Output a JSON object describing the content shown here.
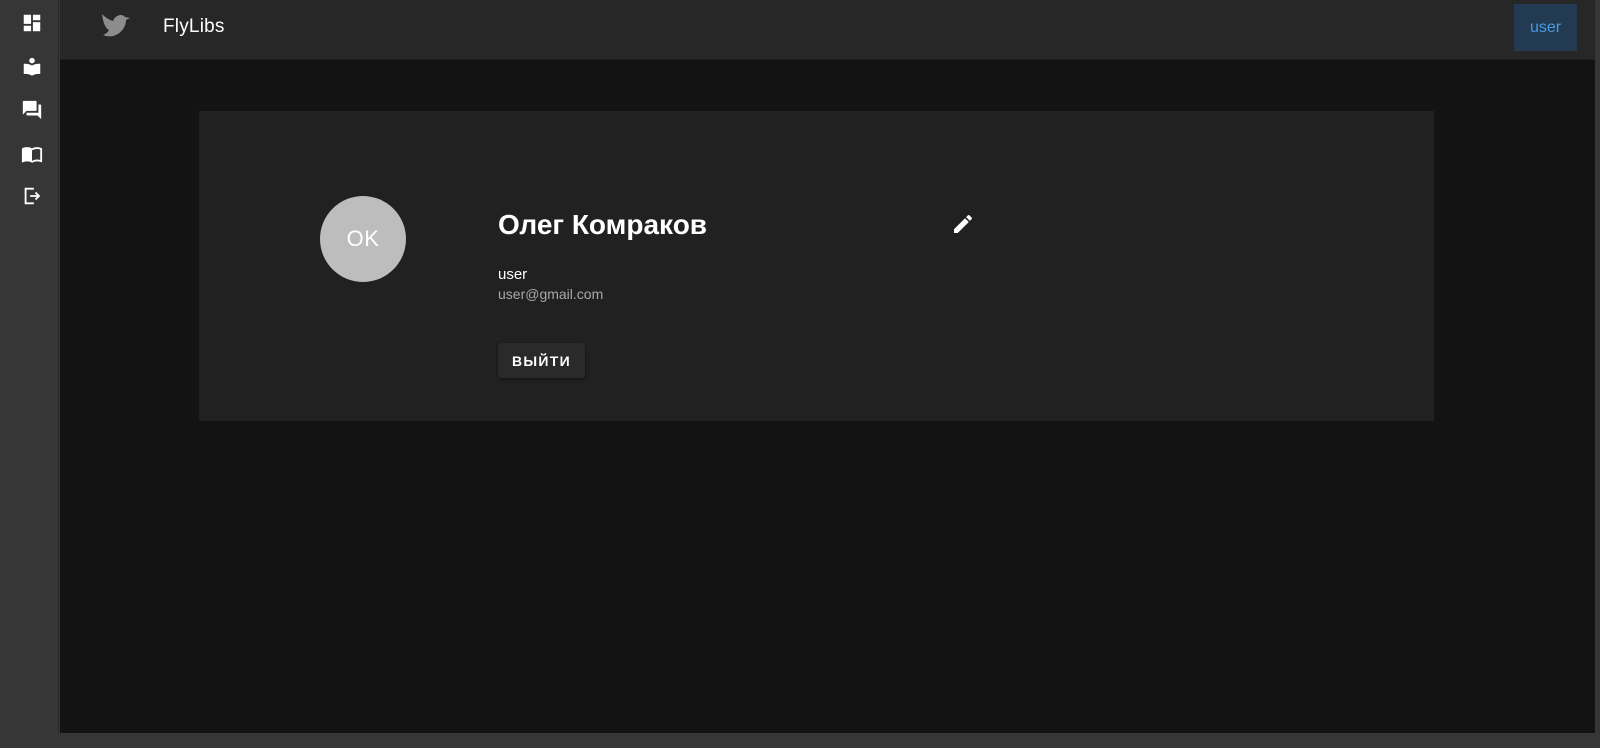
{
  "rail": {
    "items": [
      {
        "icon": "dashboard-icon"
      },
      {
        "icon": "reader-icon"
      },
      {
        "icon": "forum-icon"
      },
      {
        "icon": "book-icon"
      },
      {
        "icon": "logout-icon"
      }
    ]
  },
  "header": {
    "title": "FlyLibs",
    "logo_icon": "bird-icon",
    "user_button": "user",
    "user_button_bg": "#223a52",
    "user_button_color": "#4a9ae0"
  },
  "profile": {
    "avatar_initials": "OK",
    "avatar_color": "#bdbdbd",
    "full_name": "Олег Комраков",
    "edit_icon": "pencil-icon",
    "username": "user",
    "email": "user@gmail.com",
    "logout_label": "ВЫЙТИ"
  },
  "colors": {
    "background": "#131313",
    "card": "#212121",
    "header": "#272727",
    "rail": "#363636"
  }
}
